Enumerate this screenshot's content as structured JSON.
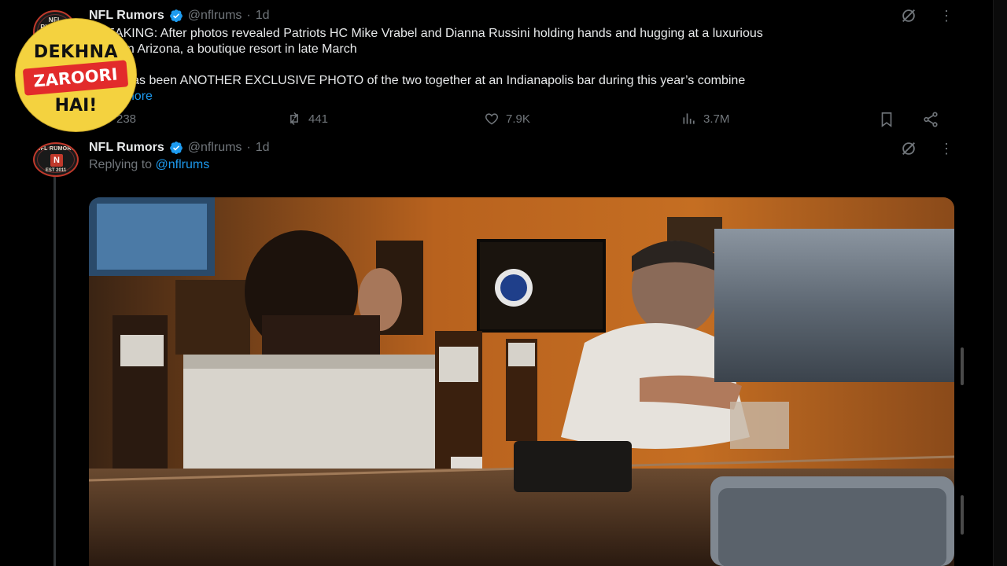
{
  "tweet1": {
    "name": "NFL Rumors",
    "handle": "@nflrums",
    "dot": "·",
    "time": "1d",
    "text_lines": [
      "BREAKING: After photos revealed Patriots HC Mike Vrabel and Dianna Russini holding hands and hugging at a luxurious",
      "resort in Arizona, a boutique resort in late March",
      "",
      "There has been ANOTHER EXCLUSIVE PHOTO of the two together  at an Indianapolis bar during this year’s combine"
    ],
    "show_more": "Show more",
    "metrics": {
      "replies": "238",
      "reposts": "441",
      "likes": "7.9K",
      "views": "3.7M"
    }
  },
  "tweet2": {
    "name": "NFL Rumors",
    "handle": "@nflrums",
    "dot": "·",
    "time": "1d",
    "replying_prefix": "Replying to",
    "replying_to": "@nflrums"
  },
  "avatar": {
    "top_text": "NFL RUMORS",
    "mid_text": "N",
    "bottom_text": "EST 2011"
  },
  "overlay_badge": {
    "line1": "DEKHNA",
    "line2": "ZAROORI",
    "line3": "HAI!"
  },
  "icons": {
    "verified": "verified-badge-icon",
    "grok": "grok-icon",
    "more": "more-icon",
    "reply": "reply-icon",
    "repost": "repost-icon",
    "like": "heart-icon",
    "views": "views-icon",
    "bookmark": "bookmark-icon",
    "share": "share-icon"
  },
  "colors": {
    "background": "#000000",
    "accent": "#1d9bf0",
    "muted": "#71767b",
    "badge_yellow": "#f4d23f",
    "badge_red": "#e22b2b"
  }
}
